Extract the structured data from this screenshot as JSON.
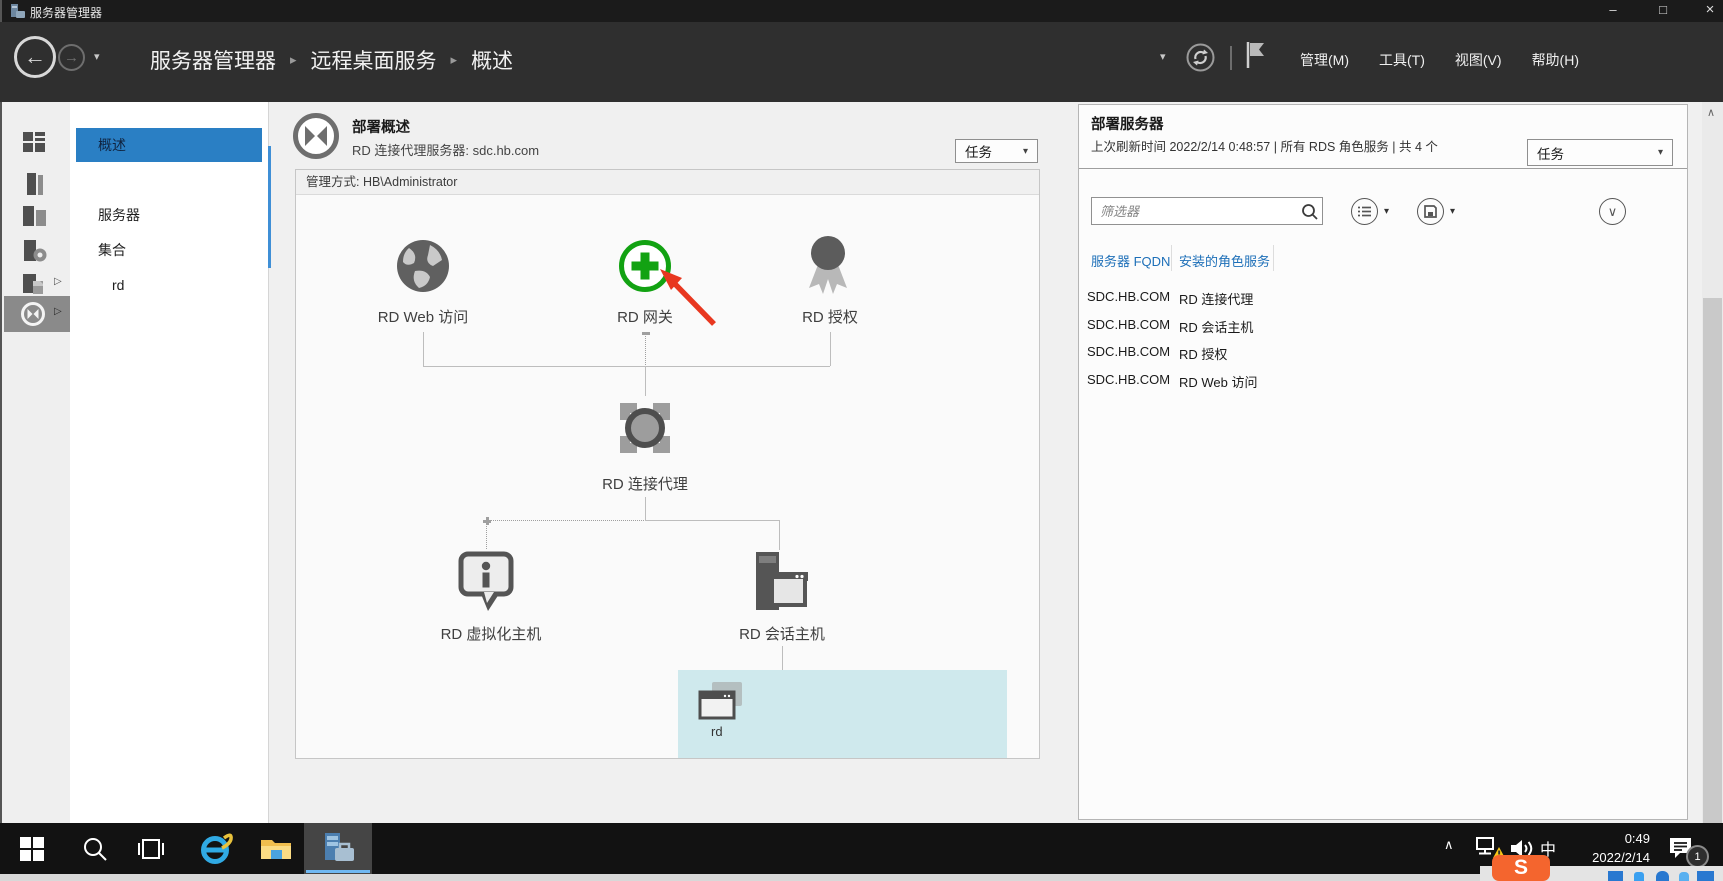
{
  "window": {
    "title": "服务器管理器"
  },
  "icons": {
    "back": "←",
    "forward": "→",
    "caret": "▾",
    "expand": "▷",
    "sep": "▸",
    "min": "–",
    "max": "□",
    "close": "×",
    "up": "∧",
    "down": "∨",
    "logo_s": "S"
  },
  "header": {
    "breadcrumbs": [
      "服务器管理器",
      "远程桌面服务",
      "概述"
    ],
    "menus": [
      {
        "label": "管理(M)"
      },
      {
        "label": "工具(T)"
      },
      {
        "label": "视图(V)"
      },
      {
        "label": "帮助(H)"
      }
    ]
  },
  "sidebar": {
    "nav_items": [
      {
        "label": "概述",
        "selected": true
      },
      {
        "label": "服务器",
        "selected": false
      },
      {
        "label": "集合",
        "selected": false
      },
      {
        "label": "rd",
        "selected": false,
        "indent": true
      }
    ]
  },
  "main": {
    "tile_title": "部署概述",
    "tile_subtitle": "RD 连接代理服务器: sdc.hb.com",
    "tasks_label": "任务",
    "managed_by": "管理方式: HB\\Administrator",
    "diagram": {
      "nodes": [
        {
          "id": "rd-web-access",
          "label": "RD Web 访问",
          "state": "installed"
        },
        {
          "id": "rd-gateway",
          "label": "RD 网关",
          "state": "not-installed-add"
        },
        {
          "id": "rd-licensing",
          "label": "RD 授权",
          "state": "installed"
        },
        {
          "id": "rd-connection-broker",
          "label": "RD 连接代理",
          "state": "installed"
        },
        {
          "id": "rd-virtualization-host",
          "label": "RD 虚拟化主机",
          "state": "not-installed"
        },
        {
          "id": "rd-session-host",
          "label": "RD 会话主机",
          "state": "installed"
        }
      ],
      "collection": {
        "label": "rd"
      }
    },
    "annotation": {
      "type": "red-arrow",
      "points_at": "rd-gateway",
      "color": "#e8371f"
    }
  },
  "right_panel": {
    "title": "部署服务器",
    "subtitle": "上次刷新时间 2022/2/14 0:48:57 | 所有 RDS 角色服务 | 共 4 个",
    "tasks_label": "任务",
    "filter_placeholder": "筛选器",
    "table": {
      "headers": [
        "服务器 FQDN",
        "安装的角色服务"
      ],
      "rows": [
        [
          "SDC.HB.COM",
          "RD 连接代理"
        ],
        [
          "SDC.HB.COM",
          "RD 会话主机"
        ],
        [
          "SDC.HB.COM",
          "RD 授权"
        ],
        [
          "SDC.HB.COM",
          "RD Web 访问"
        ]
      ]
    }
  },
  "taskbar": {
    "ime_indicator": "中",
    "clock_time": "0:49",
    "clock_date": "2022/2/14",
    "notification_count": "1"
  },
  "colors": {
    "accent_blue": "#2a7fc4",
    "link_blue": "#1d6fb8",
    "gateway_green": "#12a212",
    "collection_teal": "#cfe9ed",
    "arrow_red": "#e8371f",
    "warning_yellow": "#f8c616"
  }
}
